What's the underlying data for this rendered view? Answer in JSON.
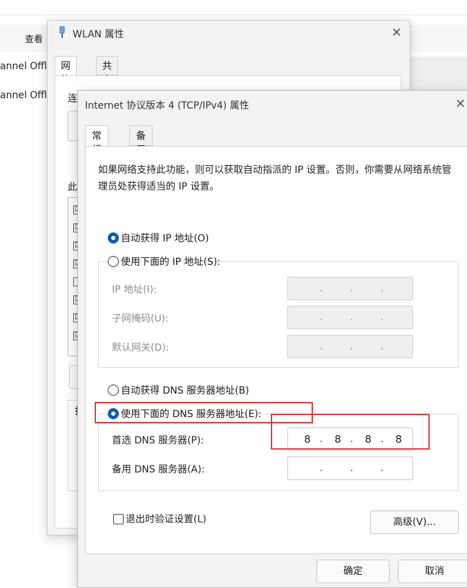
{
  "background": {
    "view_label": "查看",
    "rows": [
      "annel Offl",
      "annel Offl"
    ]
  },
  "wlan_dialog": {
    "title": "WLAN 属性",
    "tabs": [
      "网络",
      "共享"
    ],
    "connect_label": "连",
    "items_label": "此",
    "list_checks": [
      "☑",
      "☑",
      "☑",
      "☑",
      "",
      "☑",
      "☑",
      "☑"
    ],
    "side_letter": "护"
  },
  "ipv4_dialog": {
    "title": "Internet 协议版本 4 (TCP/IPv4) 属性",
    "tabs": [
      "常规",
      "备用配置"
    ],
    "description": "如果网络支持此功能，则可以获取自动指派的 IP 设置。否则，你需要从网络系统管理员处获得适当的 IP 设置。",
    "ip_auto_label": "自动获得 IP 地址(O)",
    "ip_manual_label": "使用下面的 IP 地址(S):",
    "ip_address_label": "IP 地址(I):",
    "subnet_label": "子网掩码(U):",
    "gateway_label": "默认网关(D):",
    "dns_auto_label": "自动获得 DNS 服务器地址(B)",
    "dns_manual_label": "使用下面的 DNS 服务器地址(E):",
    "preferred_dns_label": "首选 DNS 服务器(P):",
    "alternate_dns_label": "备用 DNS 服务器(A):",
    "preferred_dns": [
      "8",
      "8",
      "8",
      "8"
    ],
    "alternate_dns": [
      "",
      "",
      "",
      ""
    ],
    "validate_label": "退出时验证设置(L)",
    "advanced_button": "高级(V)...",
    "ok_button": "确定",
    "cancel_button": "取消",
    "ip_mode": "auto",
    "dns_mode": "manual",
    "validate_checked": false
  },
  "colors": {
    "accent": "#0b5cad",
    "highlight": "#e03b3b"
  }
}
